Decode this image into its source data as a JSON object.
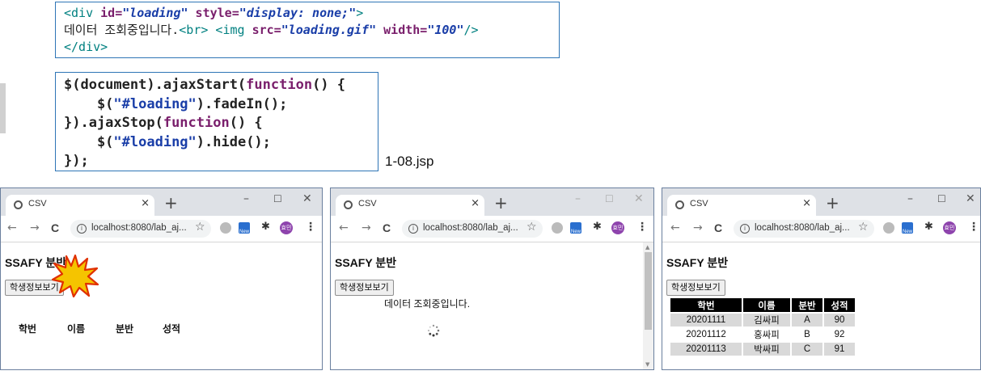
{
  "code_snippet_1": {
    "line1": {
      "open": "<div ",
      "attr1": "id=",
      "val1": "\"loading\"",
      "attr2": " style=",
      "val2": "\"display: none;\"",
      "close": ">"
    },
    "line2": {
      "text": "데이터 조회중입니다.",
      "br": "<br> ",
      "img": "<img ",
      "attr1": "src=",
      "val1": "\"loading.gif\"",
      "attr2": " width=",
      "val2": "\"100\"",
      "close": "/>"
    },
    "line3": {
      "text": "</div>"
    }
  },
  "code_snippet_2": {
    "lines": [
      {
        "a": "$(document).ajaxStart(",
        "kw": "function",
        "b": "() {"
      },
      {
        "a": "    $(",
        "s": "\"#loading\"",
        "b": ").fadeIn();"
      },
      {
        "a": "}).ajaxStop(",
        "kw": "function",
        "b": "() {"
      },
      {
        "a": "    $(",
        "s": "\"#loading\"",
        "b": ").hide();"
      },
      {
        "a": "});"
      }
    ]
  },
  "file_label": "1-08.jsp",
  "browser": {
    "tab_title": "CSV",
    "tab_close": "×",
    "new_tab": "+",
    "minimize": "–",
    "maximize": "☐",
    "close": "✕",
    "back": "←",
    "forward": "→",
    "reload": "C",
    "url": "localhost:8080/lab_aj...",
    "new_badge": "New",
    "avatar_text": "효민",
    "menu": "⋮"
  },
  "page": {
    "title": "SSAFY 분반",
    "button_label": "학생정보보기",
    "loading_text": "데이터 조회중입니다.",
    "columns": [
      "학번",
      "이름",
      "분반",
      "성적"
    ],
    "rows": [
      [
        "20201111",
        "김싸피",
        "A",
        "90"
      ],
      [
        "20201112",
        "홍싸피",
        "B",
        "92"
      ],
      [
        "20201113",
        "박싸피",
        "C",
        "91"
      ]
    ]
  },
  "colors": {
    "code_border": "#2e75b6",
    "tag": "#008080",
    "attr": "#7a1f6c",
    "string": "#1a3ea8",
    "burst_fill": "#f5c400",
    "burst_stroke": "#e03000"
  }
}
